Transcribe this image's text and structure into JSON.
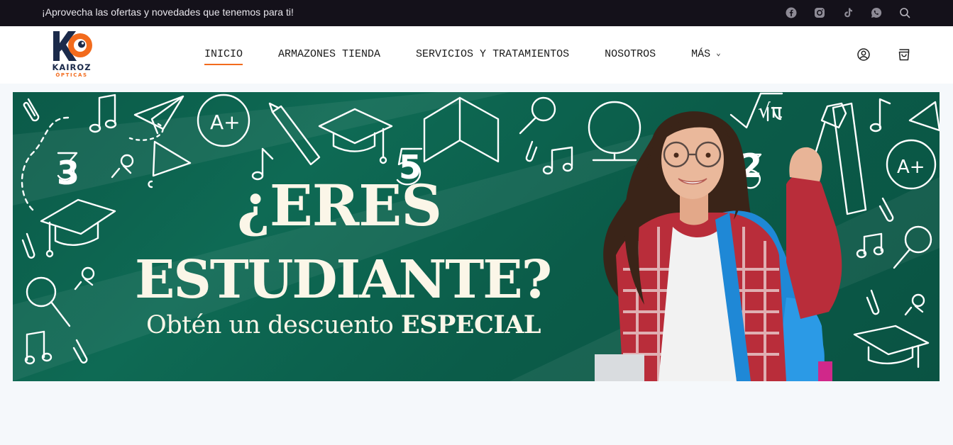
{
  "topbar": {
    "promo_text": "¡Aprovecha las ofertas y novedades que tenemos para ti!",
    "icons": [
      "facebook-icon",
      "instagram-icon",
      "tiktok-icon",
      "whatsapp-icon",
      "search-icon"
    ]
  },
  "logo": {
    "mark": "KO",
    "name": "KAIROZ",
    "sub": "ÓPTICAS"
  },
  "nav": {
    "items": [
      {
        "label": "INICIO",
        "active": true
      },
      {
        "label": "ARMAZONES TIENDA"
      },
      {
        "label": "SERVICIOS Y TRATAMIENTOS"
      },
      {
        "label": "NOSOTROS"
      },
      {
        "label": "MÁS"
      }
    ],
    "more_chevron": "⌄"
  },
  "banner": {
    "line1": "¿ERES",
    "line2": "ESTUDIANTE?",
    "line3_normal": "Obtén un descuento ",
    "line3_bold": "ESPECIAL",
    "doodle_numbers": [
      "3",
      "5",
      "2"
    ],
    "doodle_grade": "A+",
    "doodle_pi": "√π"
  },
  "colors": {
    "accent": "#f26b1d",
    "topbar_bg": "#14111a",
    "banner_green": "#0b5a48",
    "logo_navy": "#1b2a4a"
  }
}
